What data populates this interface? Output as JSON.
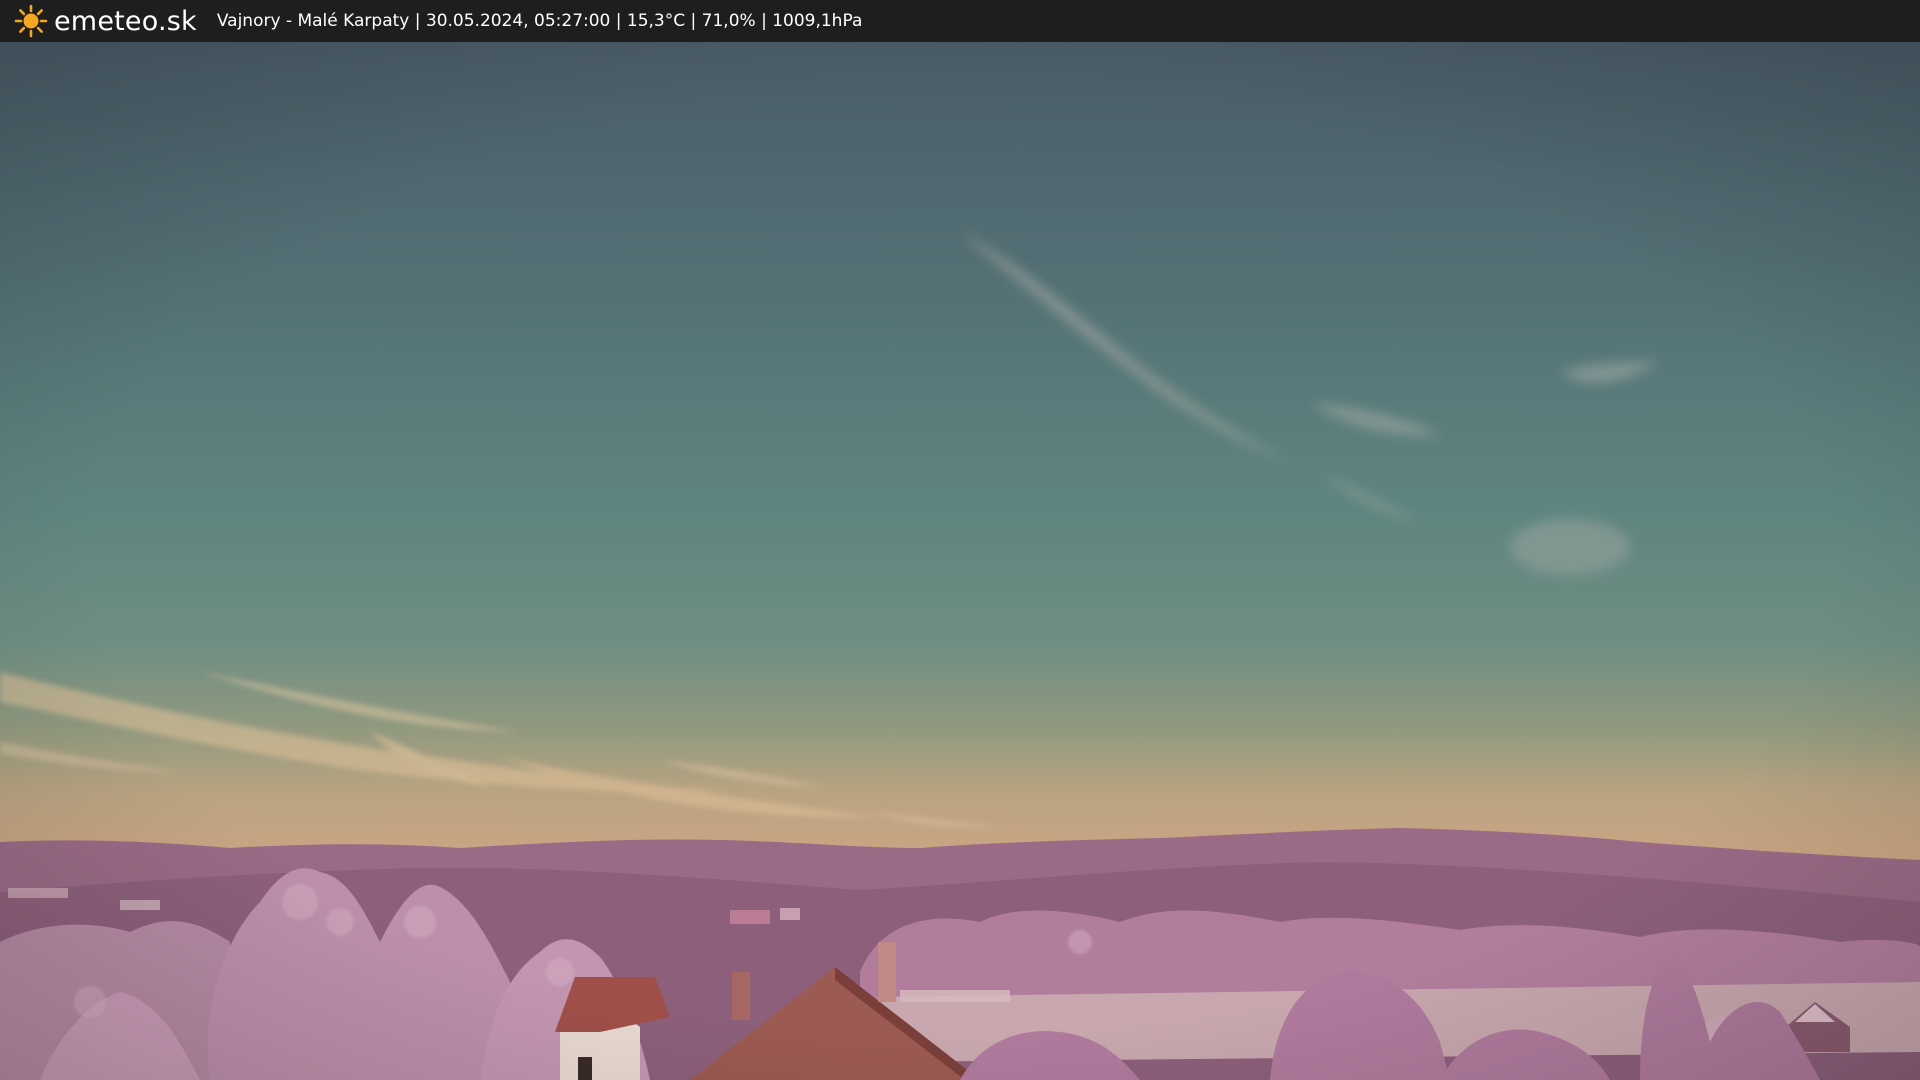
{
  "topbar": {
    "brand": "emeteo.sk",
    "info": "Vajnory - Malé Karpaty | 30.05.2024, 05:27:00 | 15,3°C | 71,0% | 1009,1hPa",
    "logo_icon": "sun-icon"
  },
  "colors": {
    "bar_bg": "#1e1e1e",
    "sun": "#f5a623",
    "sky_top": "#4a5d68",
    "sky_mid": "#5d8280",
    "sky_horizon": "#c7a57e",
    "foliage": "#b07a9a"
  }
}
